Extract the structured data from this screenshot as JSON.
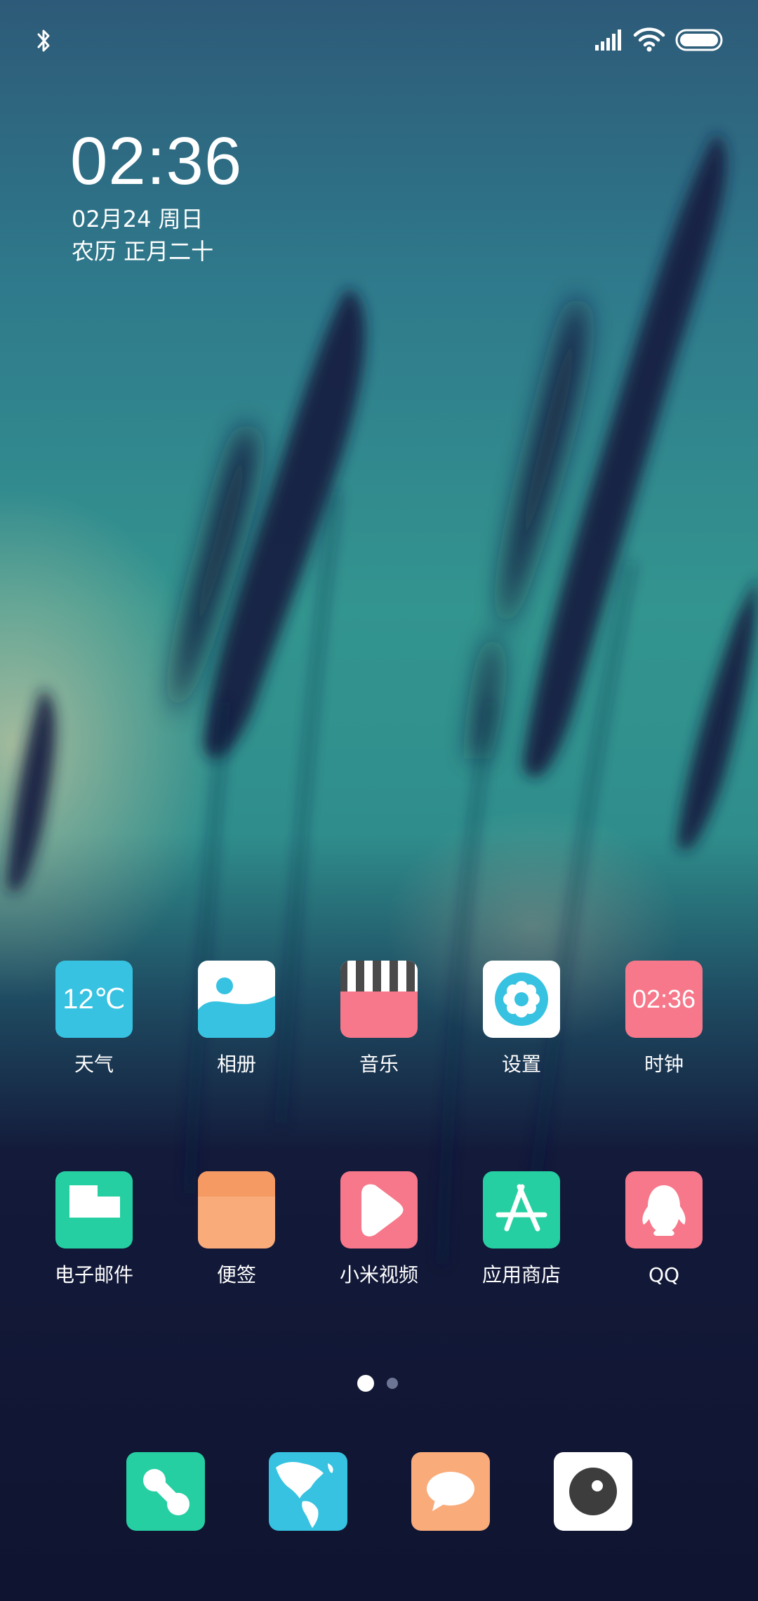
{
  "status_bar": {
    "icons": [
      "bluetooth-icon",
      "signal-icon",
      "wifi-icon",
      "battery-icon"
    ]
  },
  "clock_widget": {
    "time": "02:36",
    "date": "02月24 周日",
    "lunar": "农历 正月二十"
  },
  "apps_row1": [
    {
      "label": "天气",
      "icon": "weather-icon",
      "icon_text": "12℃",
      "color": "#36c2e0"
    },
    {
      "label": "相册",
      "icon": "gallery-icon",
      "color": "#ffffff"
    },
    {
      "label": "音乐",
      "icon": "music-icon",
      "color": "#f6788a"
    },
    {
      "label": "设置",
      "icon": "settings-icon",
      "color": "#ffffff"
    },
    {
      "label": "时钟",
      "icon": "clock-icon",
      "icon_text": "02:36",
      "color": "#f6788a"
    }
  ],
  "apps_row2": [
    {
      "label": "电子邮件",
      "icon": "email-icon",
      "color": "#26cfa2"
    },
    {
      "label": "便签",
      "icon": "notes-icon",
      "color": "#f9ab7a"
    },
    {
      "label": "小米视频",
      "icon": "video-icon",
      "color": "#f6788a"
    },
    {
      "label": "应用商店",
      "icon": "app-store-icon",
      "color": "#26cfa2"
    },
    {
      "label": "QQ",
      "icon": "qq-icon",
      "color": "#f6788a"
    }
  ],
  "page_indicator": {
    "pages": 2,
    "active": 1
  },
  "dock": [
    {
      "icon": "phone-icon",
      "color": "#26cfa2"
    },
    {
      "icon": "browser-globe-icon",
      "color": "#36c2e0"
    },
    {
      "icon": "messages-icon",
      "color": "#f9ab7a"
    },
    {
      "icon": "camera-icon",
      "color": "#ffffff"
    }
  ]
}
